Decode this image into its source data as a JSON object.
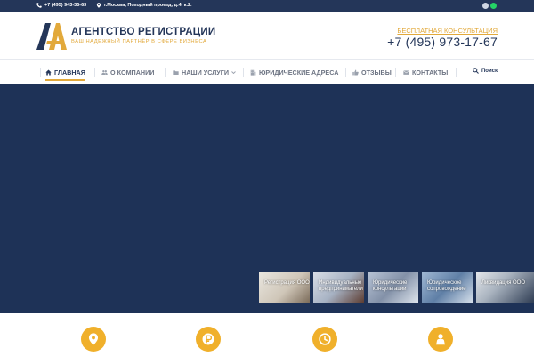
{
  "topbar": {
    "phone": "+7 (495) 943-35-63",
    "address": "г.Москва, Походный проезд, д.4, к.2."
  },
  "header": {
    "logo_title": "АГЕНТСТВО РЕГИСТРАЦИИ",
    "logo_tagline": "ВАШ НАДЕЖНЫЙ ПАРТНЁР В СФЕРЕ БИЗНЕСА",
    "consult_label": "БЕСПЛАТНАЯ КОНСУЛЬТАЦИЯ",
    "phone": "+7 (495) 973-17-67"
  },
  "nav": {
    "items": [
      {
        "label": "ГЛАВНАЯ",
        "icon": "home-icon"
      },
      {
        "label": "О КОМПАНИИ",
        "icon": "users-icon"
      },
      {
        "label": "НАШИ УСЛУГИ",
        "icon": "folder-icon"
      },
      {
        "label": "ЮРИДИЧЕСКИЕ АДРЕСА",
        "icon": "building-icon"
      },
      {
        "label": "ОТЗЫВЫ",
        "icon": "thumbs-up-icon"
      },
      {
        "label": "КОНТАКТЫ",
        "icon": "envelope-icon"
      }
    ],
    "search_label": "Поиск"
  },
  "thumbnails": [
    {
      "caption": "Регистрация ООО"
    },
    {
      "caption": "Индивидуальные предприниматели"
    },
    {
      "caption": "Юридические консультации"
    },
    {
      "caption": "Юридическое сопровождение"
    },
    {
      "caption": "Ликвидация ООО"
    }
  ],
  "features": [
    {
      "icon": "map-marker-icon"
    },
    {
      "icon": "ruble-icon"
    },
    {
      "icon": "clock-icon"
    },
    {
      "icon": "person-icon"
    }
  ],
  "colors": {
    "brand_navy": "#243659",
    "hero_navy": "#1e3257",
    "accent_gold": "#e2a93b",
    "feature_orange": "#f0b02b"
  }
}
